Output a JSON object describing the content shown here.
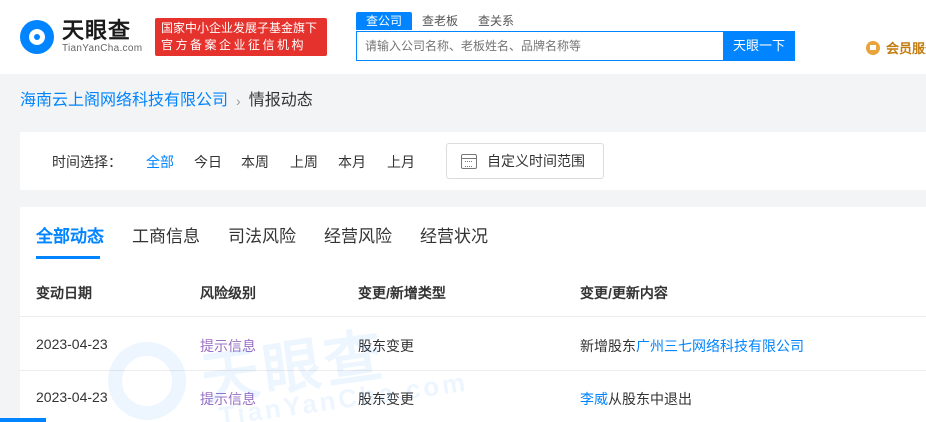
{
  "header": {
    "logo_cn": "天眼查",
    "logo_en": "TianYanCha.com",
    "badge_line1": "国家中小企业发展子基金旗下",
    "badge_line2": "官方备案企业征信机构",
    "search_tabs": [
      "查公司",
      "查老板",
      "查关系"
    ],
    "search_placeholder": "请输入公司名称、老板姓名、品牌名称等",
    "search_button": "天眼一下",
    "vip_label": "会员服务"
  },
  "breadcrumb": {
    "company": "海南云上阁网络科技有限公司",
    "separator": "›",
    "current": "情报动态"
  },
  "filter": {
    "label": "时间选择：",
    "options": [
      "全部",
      "今日",
      "本周",
      "上周",
      "本月",
      "上月"
    ],
    "active_option": "全部",
    "custom_range": "自定义时间范围"
  },
  "tabs": [
    "全部动态",
    "工商信息",
    "司法风险",
    "经营风险",
    "经营状况"
  ],
  "active_tab": "全部动态",
  "table": {
    "headers": [
      "变动日期",
      "风险级别",
      "变更/新增类型",
      "变更/更新内容"
    ],
    "rows": [
      {
        "date": "2023-04-23",
        "level": "提示信息",
        "type": "股东变更",
        "content_prefix": "新增股东",
        "content_link": "广州三七网络科技有限公司",
        "content_suffix": ""
      },
      {
        "date": "2023-04-23",
        "level": "提示信息",
        "type": "股东变更",
        "content_prefix": "",
        "content_link": "李威",
        "content_suffix": "从股东中退出"
      }
    ]
  },
  "watermark": {
    "cn": "天眼查",
    "en": "TianYanCha.com"
  },
  "colors": {
    "accent": "#0084ff",
    "badge_red": "#e5322d",
    "level_purple": "#9a6fc4",
    "vip_gold": "#c27c0e"
  }
}
